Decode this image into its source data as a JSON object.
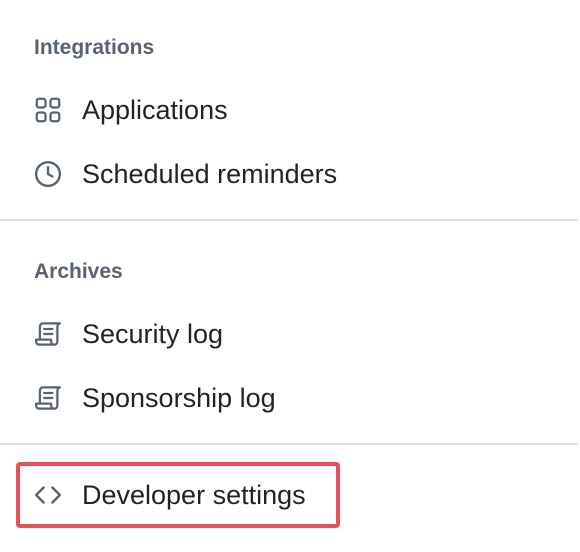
{
  "sections": [
    {
      "heading": "Integrations",
      "items": [
        {
          "label": "Applications",
          "icon": "apps-icon"
        },
        {
          "label": "Scheduled reminders",
          "icon": "clock-icon"
        }
      ]
    },
    {
      "heading": "Archives",
      "items": [
        {
          "label": "Security log",
          "icon": "log-icon"
        },
        {
          "label": "Sponsorship log",
          "icon": "log-icon"
        }
      ]
    }
  ],
  "developer": {
    "label": "Developer settings",
    "icon": "code-icon"
  },
  "colors": {
    "heading": "#59636e",
    "text": "#1f2328",
    "divider": "#d8dee4",
    "highlight": "#e9505b"
  }
}
